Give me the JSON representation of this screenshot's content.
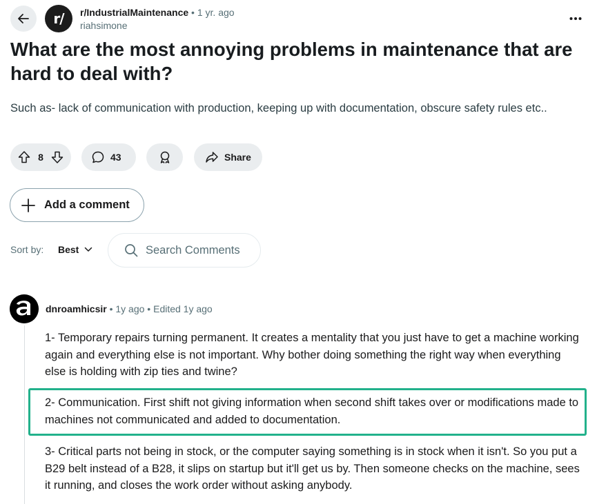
{
  "post": {
    "subreddit": "r/IndustrialMaintenance",
    "separator": "•",
    "age": "1 yr. ago",
    "author": "riahsimone",
    "avatar_text": "r/",
    "title": "What are the most annoying problems in maintenance that are hard to deal with?",
    "body": "Such as- lack of communication with production, keeping up with documentation, obscure safety rules etc.."
  },
  "actions": {
    "vote_count": "8",
    "comment_count": "43",
    "share_label": "Share",
    "add_comment_label": "Add a comment"
  },
  "sort": {
    "label": "Sort by:",
    "value": "Best",
    "search_placeholder": "Search Comments"
  },
  "comment": {
    "author": "dnroamhicsir",
    "meta": "• 1y ago • Edited 1y ago",
    "paragraphs": [
      "1- Temporary repairs turning permanent. It creates a mentality that you just have to get a machine working again and everything else is not important. Why bother doing something the right way when everything else is holding with zip ties and twine?",
      "2- Communication. First shift not giving information when second shift takes over or modifications made to machines not communicated and added to documentation.",
      "3- Critical parts not being in stock, or the computer saying something is in stock when it isn't. So you put a B29 belt instead of a B28, it slips on startup but it'll get us by. Then someone checks on the machine, sees it running, and closes the work order without asking anybody."
    ]
  },
  "icons": [
    "back-arrow-icon",
    "more-options-icon",
    "upvote-icon",
    "downvote-icon",
    "comment-icon",
    "award-icon",
    "share-icon",
    "plus-icon",
    "chevron-down-icon",
    "search-icon"
  ],
  "colors": {
    "highlight": "#22b18b",
    "pill_bg": "#eaedef",
    "meta_gray": "#576f76"
  }
}
